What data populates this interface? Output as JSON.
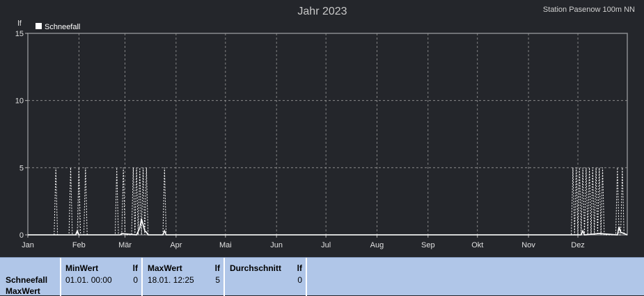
{
  "chart_data": {
    "type": "line",
    "title": "Jahr 2023",
    "station": "Station Pasenow 100m NN",
    "ylabel": "lf",
    "ylim": [
      0,
      15
    ],
    "yticks": [
      0,
      5,
      10,
      15
    ],
    "xlim": [
      "2023-01-01",
      "2023-12-31"
    ],
    "xticks": [
      "Jan",
      "Feb",
      "Mär",
      "Apr",
      "Mai",
      "Jun",
      "Jul",
      "Aug",
      "Sep",
      "Okt",
      "Nov",
      "Dez"
    ],
    "grid": true,
    "legend_position": "top-left",
    "series": [
      {
        "name": "Schneefall",
        "style": "solid",
        "color": "#ffffff",
        "x": [
          "2023-01-01",
          "2023-01-30",
          "2023-01-31",
          "2023-02-01",
          "2023-02-26",
          "2023-02-27",
          "2023-03-08",
          "2023-03-10",
          "2023-03-11",
          "2023-03-13",
          "2023-03-14",
          "2023-03-15",
          "2023-03-24",
          "2023-03-25",
          "2023-03-26",
          "2023-11-30",
          "2023-12-03",
          "2023-12-04",
          "2023-12-05",
          "2023-12-14",
          "2023-12-25",
          "2023-12-26",
          "2023-12-27",
          "2023-12-31"
        ],
        "y": [
          0,
          0,
          0.3,
          0,
          0,
          0.1,
          0,
          0.5,
          1.2,
          0.3,
          0.2,
          0,
          0,
          0.3,
          0,
          0,
          0,
          0.3,
          0,
          0.1,
          0,
          0.6,
          0.2,
          0
        ]
      },
      {
        "name": "MaxWert",
        "style": "dashed",
        "color": "#ffffff",
        "x": [
          "2023-01-17",
          "2023-01-18",
          "2023-01-19",
          "2023-01-26",
          "2023-01-27",
          "2023-01-28",
          "2023-01-31",
          "2023-02-01",
          "2023-02-02",
          "2023-02-04",
          "2023-02-05",
          "2023-02-06",
          "2023-02-23",
          "2023-02-24",
          "2023-02-25",
          "2023-02-27",
          "2023-02-28",
          "2023-03-01",
          "2023-03-05",
          "2023-03-06",
          "2023-03-07",
          "2023-03-08",
          "2023-03-09",
          "2023-03-10",
          "2023-03-11",
          "2023-03-12",
          "2023-03-13",
          "2023-03-14",
          "2023-03-15",
          "2023-03-24",
          "2023-03-25",
          "2023-03-26",
          "2023-11-27",
          "2023-11-28",
          "2023-11-29",
          "2023-11-30",
          "2023-12-01",
          "2023-12-02",
          "2023-12-03",
          "2023-12-04",
          "2023-12-05",
          "2023-12-06",
          "2023-12-07",
          "2023-12-08",
          "2023-12-09",
          "2023-12-10",
          "2023-12-11",
          "2023-12-12",
          "2023-12-13",
          "2023-12-14",
          "2023-12-15",
          "2023-12-16",
          "2023-12-17",
          "2023-12-18",
          "2023-12-24",
          "2023-12-25",
          "2023-12-26",
          "2023-12-27",
          "2023-12-28",
          "2023-12-29"
        ],
        "y": [
          0,
          5,
          0,
          0,
          5,
          0,
          0,
          5,
          0,
          0,
          5,
          0,
          0,
          5,
          0,
          0,
          5,
          0,
          0,
          5,
          0,
          5,
          0,
          5,
          0,
          5,
          0,
          5,
          0,
          0,
          5,
          0,
          0,
          5,
          0,
          5,
          0,
          5,
          0,
          5,
          0,
          5,
          0,
          5,
          0,
          5,
          0,
          5,
          0,
          5,
          0,
          5,
          0,
          0,
          0,
          5,
          0,
          0,
          5,
          0
        ]
      }
    ]
  },
  "legend": {
    "label": "Schneefall"
  },
  "footer": {
    "row_labels": [
      "Schneefall",
      "MaxWert"
    ],
    "columns": [
      {
        "header": "MinWert",
        "unit": "lf",
        "date": "01.01.  00:00",
        "value": "0"
      },
      {
        "header": "MaxWert",
        "unit": "lf",
        "date": "18.01.  12:25",
        "value": "5"
      },
      {
        "header": "Durchschnitt",
        "unit": "lf",
        "date": "",
        "value": "0"
      }
    ]
  }
}
